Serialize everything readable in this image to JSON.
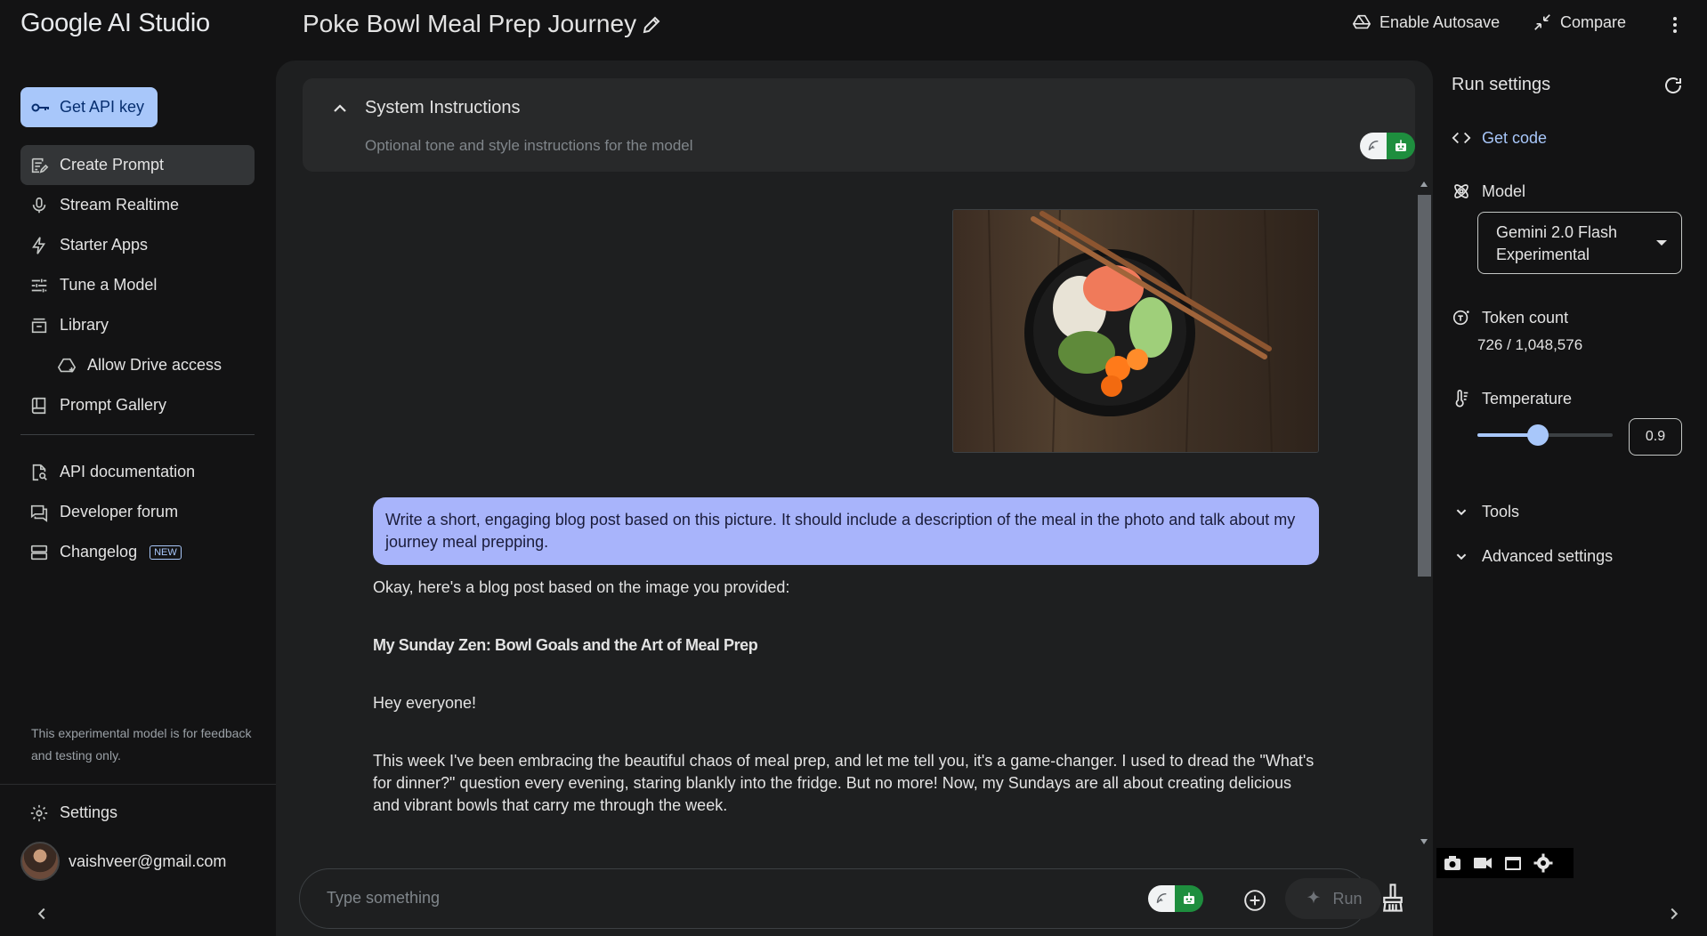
{
  "sidebar": {
    "brand": "Google AI Studio",
    "api_key_label": "Get API key",
    "items": [
      {
        "label": "Create Prompt",
        "icon": "create-prompt-icon"
      },
      {
        "label": "Stream Realtime",
        "icon": "mic-icon"
      },
      {
        "label": "Starter Apps",
        "icon": "bolt-icon"
      },
      {
        "label": "Tune a Model",
        "icon": "tune-icon"
      },
      {
        "label": "Library",
        "icon": "library-icon"
      },
      {
        "label": "Allow Drive access",
        "icon": "drive-icon"
      },
      {
        "label": "Prompt Gallery",
        "icon": "book-icon"
      }
    ],
    "links": [
      {
        "label": "API documentation",
        "icon": "doc-search-icon"
      },
      {
        "label": "Developer forum",
        "icon": "forum-icon"
      },
      {
        "label": "Changelog",
        "icon": "changelog-icon",
        "badge": "NEW"
      }
    ],
    "disclaimer": "This experimental model is for feedback and testing only.",
    "settings_label": "Settings",
    "user_email": "vaishveer@gmail.com"
  },
  "header": {
    "title": "Poke Bowl Meal Prep Journey",
    "autosave_label": "Enable Autosave",
    "compare_label": "Compare"
  },
  "system_instructions": {
    "heading": "System Instructions",
    "placeholder": "Optional tone and style instructions for the model"
  },
  "chat": {
    "user_message": "Write a short, engaging blog post based on this picture. It should include a description of the meal in the photo and talk about my journey meal prepping.",
    "model_paragraphs": [
      "Okay, here's a blog post based on the image you provided:",
      "My Sunday Zen: Bowl Goals and the Art of Meal Prep",
      "Hey everyone!",
      "This week I've been embracing the beautiful chaos of meal prep, and let me tell you, it's a game-changer. I used to dread the \"What's for dinner?\" question every evening, staring blankly into the fridge. But no more! Now, my Sundays are all about creating delicious and vibrant bowls that carry me through the week."
    ]
  },
  "composer": {
    "placeholder": "Type something",
    "run_label": "Run"
  },
  "run_settings": {
    "title": "Run settings",
    "get_code_label": "Get code",
    "model_label": "Model",
    "model_value": "Gemini 2.0 Flash Experimental",
    "token_label": "Token count",
    "token_value": "726 / 1,048,576",
    "temperature_label": "Temperature",
    "temperature_value": "0.9",
    "temperature_fraction": 0.45,
    "tools_label": "Tools",
    "advanced_label": "Advanced settings"
  },
  "colors": {
    "accent": "#a8c7fa",
    "user_bubble": "#a8b4fb",
    "toggle_green": "#1e8e3e"
  }
}
